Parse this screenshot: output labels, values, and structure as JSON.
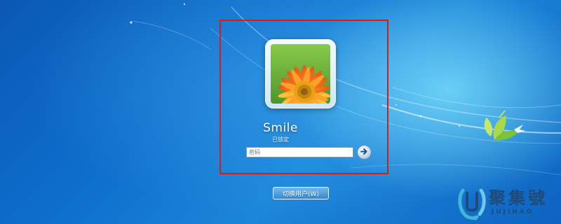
{
  "user": {
    "name": "Smile",
    "status": "已锁定"
  },
  "password": {
    "placeholder": "密码"
  },
  "go_button": {
    "icon": "arrow-right-icon"
  },
  "switch_user": {
    "label": "切换用户(W)"
  },
  "watermark": {
    "name": "聚集號",
    "sub": "JUJIHAO"
  },
  "colors": {
    "highlight": "#d71a1a",
    "background": "#0e6fcd",
    "watermark": "#1f4a7a"
  }
}
